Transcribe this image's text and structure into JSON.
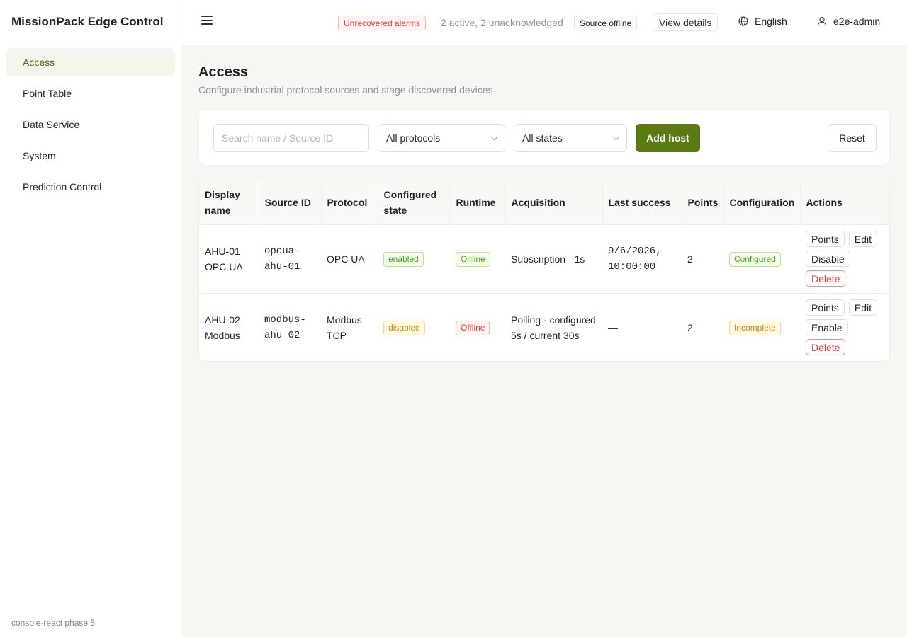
{
  "app": {
    "title": "MissionPack Edge Control",
    "footer": "console-react phase 5"
  },
  "sidebar": {
    "items": [
      {
        "label": "Access",
        "active": true
      },
      {
        "label": "Point Table"
      },
      {
        "label": "Data Service"
      },
      {
        "label": "System"
      },
      {
        "label": "Prediction Control"
      }
    ]
  },
  "topbar": {
    "alarm_badge": "Unrecovered alarms",
    "alarm_summary": "2 active, 2 unacknowledged",
    "source_badge": "Source offline",
    "view_details": "View details",
    "language": "English",
    "user": "e2e-admin",
    "icons": {
      "menu": "hamburger-icon",
      "language": "globe-icon",
      "user": "user-icon"
    }
  },
  "page": {
    "title": "Access",
    "subtitle": "Configure industrial protocol sources and stage discovered devices"
  },
  "filters": {
    "search_placeholder": "Search name / Source ID",
    "protocol": "All protocols",
    "state": "All states",
    "add_host": "Add host",
    "reset": "Reset"
  },
  "table": {
    "headers": {
      "display_name": "Display name",
      "source_id": "Source ID",
      "protocol": "Protocol",
      "configured_state": "Configured state",
      "runtime": "Runtime",
      "acquisition": "Acquisition",
      "last_success": "Last success",
      "points": "Points",
      "configuration": "Configuration",
      "actions": "Actions"
    },
    "rows": [
      {
        "display_name": "AHU-01 OPC UA",
        "source_id": "opcua-ahu-01",
        "protocol": "OPC UA",
        "configured_state": "enabled",
        "runtime": "Online",
        "acquisition": "Subscription · 1s",
        "last_success": "9/6/2026, 10:00:00",
        "points": "2",
        "configuration": "Configured",
        "actions": {
          "points": "Points",
          "edit": "Edit",
          "toggle": "Disable",
          "delete": "Delete"
        }
      },
      {
        "display_name": "AHU-02 Modbus",
        "source_id": "modbus-ahu-02",
        "protocol": "Modbus TCP",
        "configured_state": "disabled",
        "runtime": "Offline",
        "acquisition": "Polling · configured 5s / current 30s",
        "last_success": "—",
        "points": "2",
        "configuration": "Incomplete",
        "actions": {
          "points": "Points",
          "edit": "Edit",
          "toggle": "Enable",
          "delete": "Delete"
        }
      }
    ]
  },
  "colors": {
    "accent": "#5a7a14",
    "danger": "#e0403f",
    "success": "#46a418",
    "warning": "#d08a00"
  }
}
